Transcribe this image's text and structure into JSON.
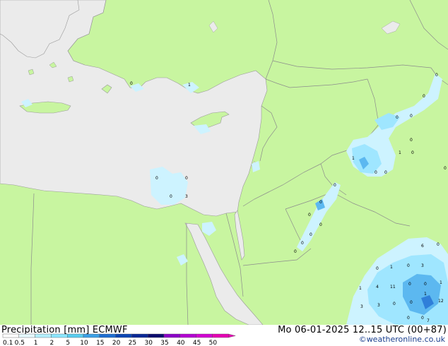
{
  "legend": {
    "title": "Precipitation [mm]",
    "model": "ECMWF",
    "datetime": "Mo 06-01-2025 12..15 UTC (00+87)",
    "credit": "©weatheronline.co.uk",
    "scale_labels": [
      "0.1",
      "0.5",
      "1",
      "2",
      "5",
      "10",
      "15",
      "20",
      "25",
      "30",
      "35",
      "40",
      "45",
      "50"
    ],
    "scale_colors": [
      "#ffffff",
      "#e6f9ff",
      "#b4f0ff",
      "#8ce6ff",
      "#5acdf0",
      "#3ca0e6",
      "#1e6ed2",
      "#0a46b4",
      "#082896",
      "#0a0a6e",
      "#8c00c8",
      "#b400d2",
      "#d200d2",
      "#e600b4"
    ]
  },
  "map": {
    "colors": {
      "sea": "#ebebeb",
      "land": "#c8f5a0",
      "border": "#8c8c8c",
      "coast": "#9a9a9a",
      "precip_light": "#cdf3ff",
      "precip_mid": "#9fe6ff",
      "precip_strong": "#5cb8f0",
      "precip_heavy": "#2f7fd9"
    },
    "precip_values": [
      "0",
      "1",
      "0",
      "0",
      "0",
      "3",
      "0",
      "0",
      "0",
      "0",
      "0",
      "1",
      "0",
      "1",
      "0",
      "0",
      "0",
      "0",
      "0",
      "0",
      "0",
      "0",
      "0",
      "0",
      "1",
      "0",
      "3",
      "0",
      "1",
      "4",
      "11",
      "0",
      "1",
      "0",
      "3",
      "3",
      "0",
      "12",
      "6",
      "7",
      "0",
      "0",
      "1",
      "0",
      "0"
    ]
  }
}
